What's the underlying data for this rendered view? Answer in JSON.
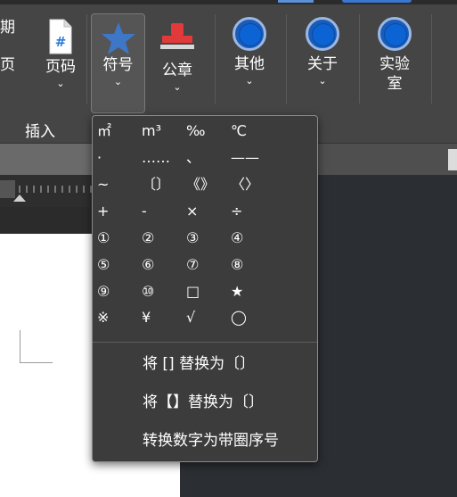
{
  "ribbon": {
    "partial_top_label": "期",
    "partial_bottom_label": "页",
    "page_number_label": "页码",
    "symbol_label": "符号",
    "seal_label": "公章",
    "other_label": "其他",
    "about_label": "关于",
    "lab_label": "实验室",
    "insert_group_label": "插入"
  },
  "symbols": [
    [
      "㎡",
      "m³",
      "‰",
      "℃"
    ],
    [
      "·",
      "……",
      "、",
      "——"
    ],
    [
      "~",
      "〔〕",
      "《》",
      "〈〉"
    ],
    [
      "+",
      "-",
      "×",
      "÷"
    ],
    [
      "①",
      "②",
      "③",
      "④"
    ],
    [
      "⑤",
      "⑥",
      "⑦",
      "⑧"
    ],
    [
      "⑨",
      "⑩",
      "□",
      "★"
    ],
    [
      "※",
      "¥",
      "√",
      "◯"
    ]
  ],
  "menu_actions": [
    "将 [] 替换为〔〕",
    "将【】替换为〔〕",
    "转换数字为带圈序号"
  ],
  "colors": {
    "ribbon_bg": "#454545",
    "menu_bg": "#3c3c3c",
    "accent_blue": "#0b63d4",
    "star_blue": "#3f77c8"
  },
  "icons": {
    "page_number": "page-number-icon",
    "symbol": "star-icon",
    "seal": "seal-stamp-icon",
    "other": "blue-circle-icon",
    "about": "blue-circle-icon",
    "lab": "blue-circle-icon"
  }
}
